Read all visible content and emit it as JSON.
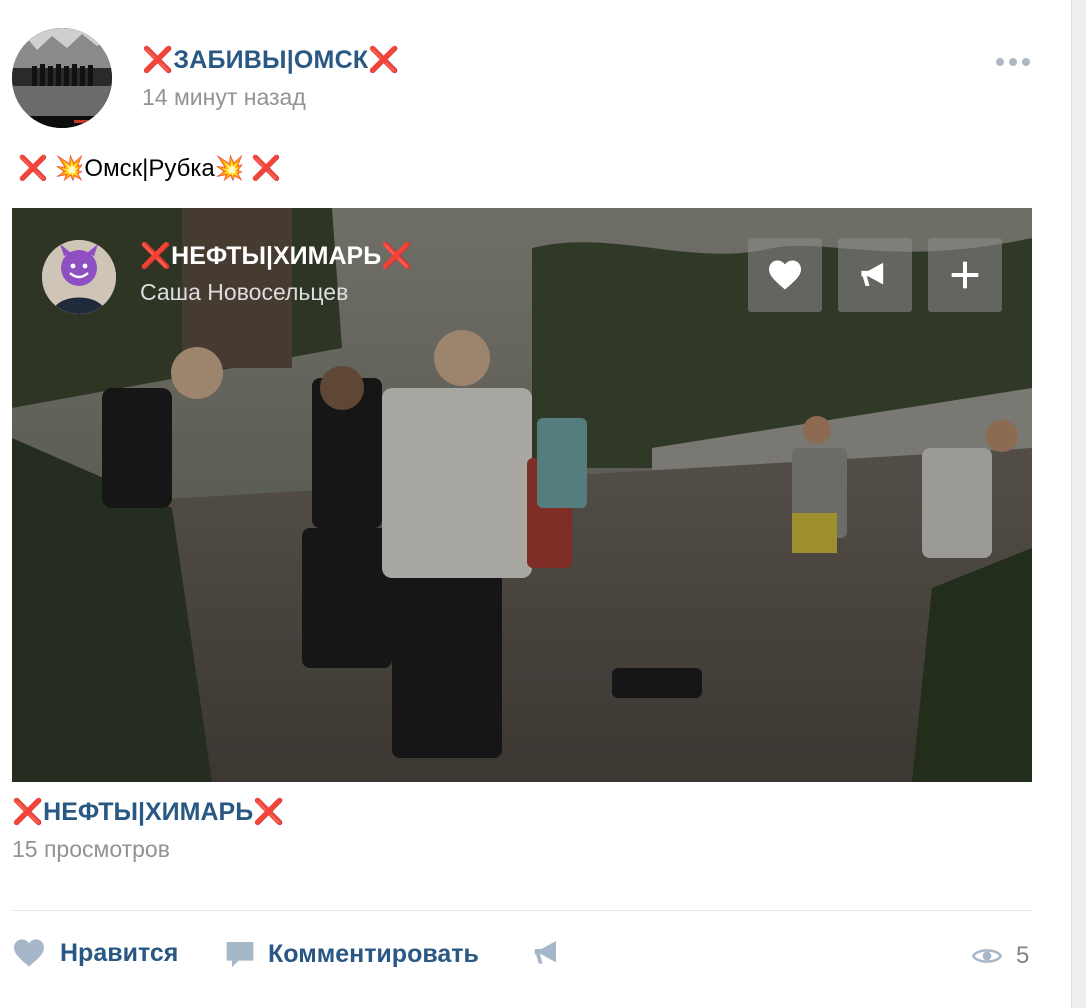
{
  "post": {
    "author_prefix": "❌",
    "author_name": "ЗАБИВЫ|ОМСК",
    "author_suffix": "❌",
    "time": "14 минут назад",
    "text": "❌ 💥Омск|Рубка💥 ❌"
  },
  "video": {
    "title_prefix": "❌",
    "title_name": "НЕФТЫ|ХИМАРЬ",
    "title_suffix": "❌",
    "subtitle": "Саша Новосельцев",
    "link_prefix": "❌",
    "link_name": "НЕФТЫ|ХИМАРЬ",
    "link_suffix": "❌",
    "views": "15 просмотров"
  },
  "actions": {
    "like": "Нравится",
    "comment": "Комментировать",
    "view_count": "5"
  },
  "colors": {
    "link": "#2a5885",
    "muted": "#939393",
    "cross": "#e0191e"
  }
}
